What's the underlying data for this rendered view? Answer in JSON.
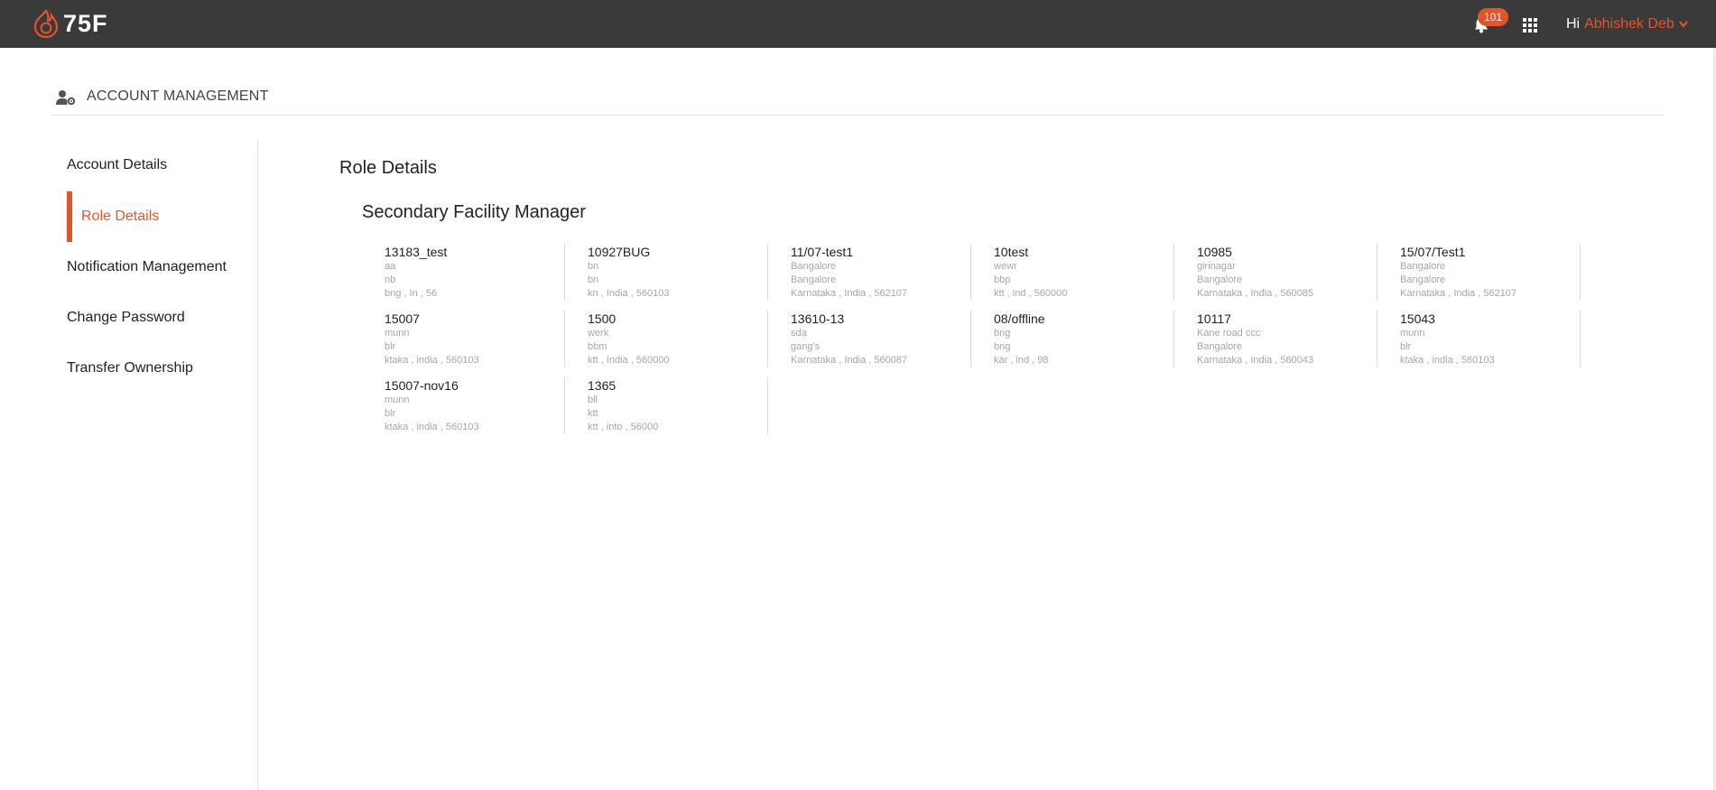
{
  "topbar": {
    "logo_text": "75F",
    "notification_count": "101",
    "greeting": "Hi",
    "user_name": "Abhishek Deb",
    "colors": {
      "bar": "#3a3a3a",
      "accent": "#e2552a"
    },
    "icons": [
      "logo-flame-icon",
      "bell-icon",
      "apps-grid-icon",
      "chevron-down-icon"
    ]
  },
  "page": {
    "title": "ACCOUNT MANAGEMENT",
    "icon": "user-gear-icon"
  },
  "sidebar": {
    "items": [
      {
        "label": "Account Details",
        "active": false
      },
      {
        "label": "Role Details",
        "active": true
      },
      {
        "label": "Notification Management",
        "active": false
      },
      {
        "label": "Change Password",
        "active": false
      },
      {
        "label": "Transfer Ownership",
        "active": false
      }
    ]
  },
  "main": {
    "title": "Role Details",
    "role": "Secondary Facility Manager",
    "facilities": [
      {
        "name": "13183_test",
        "line1": "aa",
        "line2": "nb",
        "line3": "bng , In , 56"
      },
      {
        "name": "10927BUG",
        "line1": "bn",
        "line2": "bn",
        "line3": "kn , India , 560103"
      },
      {
        "name": "11/07-test1",
        "line1": "Bangalore",
        "line2": "Bangalore",
        "line3": "Karnataka , India , 562107"
      },
      {
        "name": "10test",
        "line1": "wewr",
        "line2": "bbp",
        "line3": "ktt , ind , 560000"
      },
      {
        "name": "10985",
        "line1": "girinagar",
        "line2": "Bangalore",
        "line3": "Karnataka , India , 560085"
      },
      {
        "name": "15/07/Test1",
        "line1": "Bangalore",
        "line2": "Bangalore",
        "line3": "Karnataka , India , 562107"
      },
      {
        "name": "15007",
        "line1": "munn",
        "line2": "blr",
        "line3": "ktaka , india , 560103"
      },
      {
        "name": "1500",
        "line1": "werk",
        "line2": "bbm",
        "line3": "ktt , India , 560000"
      },
      {
        "name": "13610-13",
        "line1": "sda",
        "line2": "gang's",
        "line3": "Karnataka , India , 560087"
      },
      {
        "name": "08/offline",
        "line1": "bng",
        "line2": "bng",
        "line3": "kar , ind , 98"
      },
      {
        "name": "10117",
        "line1": "Kane road ccc",
        "line2": "Bangalore",
        "line3": "Karnataka , India , 560043"
      },
      {
        "name": "15043",
        "line1": "munn",
        "line2": "blr",
        "line3": "ktaka , india , 560103"
      },
      {
        "name": "15007-nov16",
        "line1": "munn",
        "line2": "blr",
        "line3": "ktaka , india , 560103"
      },
      {
        "name": "1365",
        "line1": "bll",
        "line2": "ktt",
        "line3": "ktt , into , 56000"
      }
    ]
  }
}
